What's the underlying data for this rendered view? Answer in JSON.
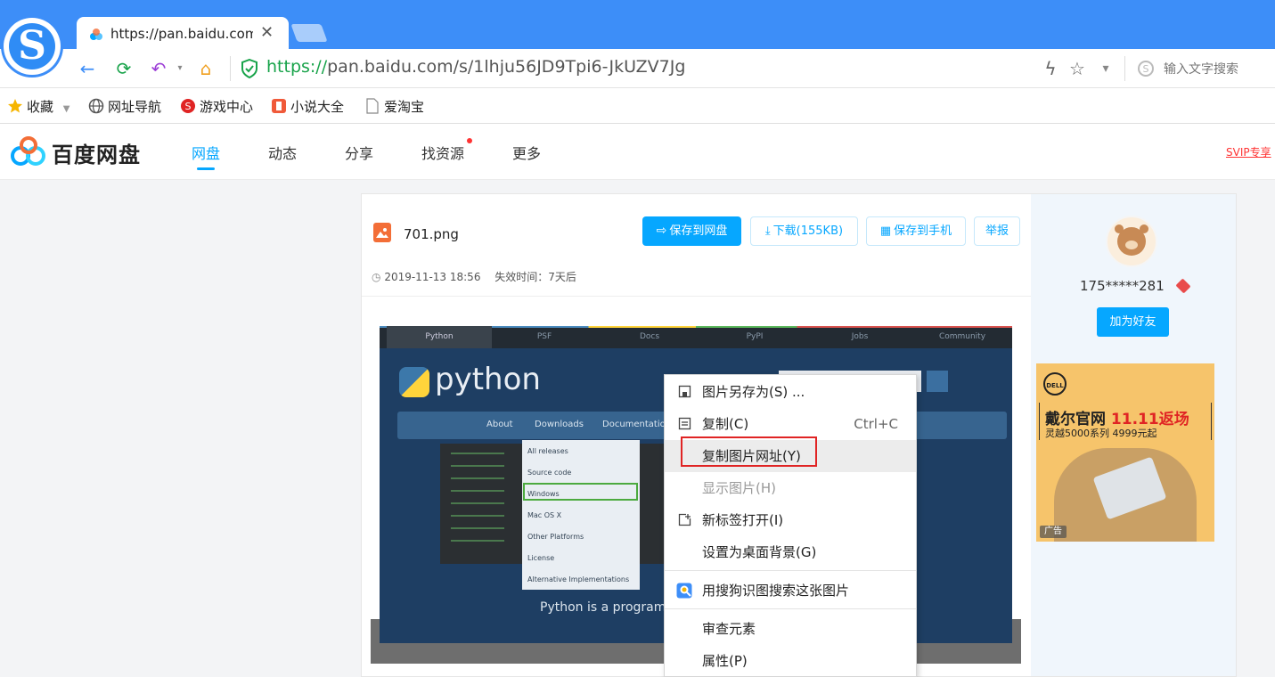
{
  "browser": {
    "tab_title": "https://pan.baidu.com",
    "url_protocol": "https://",
    "url_rest": "pan.baidu.com/s/1lhju56JD9Tpi6-JkUZV7Jg",
    "search_placeholder": "输入文字搜索",
    "close_glyph": "✕",
    "back_glyph": "←",
    "refresh_glyph": "⟳",
    "undo_glyph": "↶",
    "home_glyph": "⌂",
    "lightning_glyph": "ϟ",
    "star_glyph": "☆",
    "menu_glyph": "▾"
  },
  "bookmarks": [
    {
      "label": "收藏",
      "icon": "star-icon"
    },
    {
      "label": "网址导航",
      "icon": "globe-icon"
    },
    {
      "label": "游戏中心",
      "icon": "game-icon"
    },
    {
      "label": "小说大全",
      "icon": "book-icon"
    },
    {
      "label": "爱淘宝",
      "icon": "page-icon"
    }
  ],
  "site": {
    "name": "百度网盘",
    "nav": [
      "网盘",
      "动态",
      "分享",
      "找资源",
      "更多"
    ],
    "svip_link": "SVIP专享"
  },
  "file": {
    "name": "701.png",
    "date": "2019-11-13 18:56",
    "expire_label": "失效时间：7天后",
    "buttons": {
      "save": "保存到网盘",
      "download": "下载(155KB)",
      "save_phone": "保存到手机",
      "report": "举报"
    }
  },
  "preview": {
    "tabs": [
      "Python",
      "PSF",
      "Docs",
      "PyPI",
      "Jobs",
      "Community"
    ],
    "logo_text": "python",
    "menu": [
      "About",
      "Downloads",
      "Documentation"
    ],
    "dropdown": [
      "All releases",
      "Source code",
      "Windows",
      "Mac OS X",
      "Other Platforms",
      "License",
      "Alternative Implementations"
    ],
    "footer_text": "Python is a programming"
  },
  "sidebar": {
    "username": "175*****281",
    "add_friend": "加为好友",
    "ad": {
      "brand": "DELL",
      "title_black": "戴尔官网 ",
      "title_red": "11.11返场",
      "subtitle": "灵越5000系列 4999元起",
      "tag": "广告"
    }
  },
  "context_menu": {
    "items": [
      {
        "label": "图片另存为(S) ...",
        "shortcut": "",
        "icon": "save-image-icon"
      },
      {
        "label": "复制(C)",
        "shortcut": "Ctrl+C",
        "icon": "copy-icon"
      },
      {
        "label": "复制图片网址(Y)",
        "shortcut": "",
        "icon": ""
      },
      {
        "label": "显示图片(H)",
        "shortcut": "",
        "icon": ""
      },
      {
        "label": "新标签打开(I)",
        "shortcut": "",
        "icon": "new-tab-icon"
      },
      {
        "label": "设置为桌面背景(G)",
        "shortcut": "",
        "icon": ""
      },
      {
        "label": "用搜狗识图搜索这张图片",
        "shortcut": "",
        "icon": "sogou-image-search-icon"
      },
      {
        "label": "审查元素",
        "shortcut": "",
        "icon": ""
      },
      {
        "label": "属性(P)",
        "shortcut": "",
        "icon": ""
      }
    ]
  },
  "colors": {
    "accent": "#06a7ff",
    "browser_blue": "#3d8ef8",
    "highlight_red": "#e02424"
  }
}
